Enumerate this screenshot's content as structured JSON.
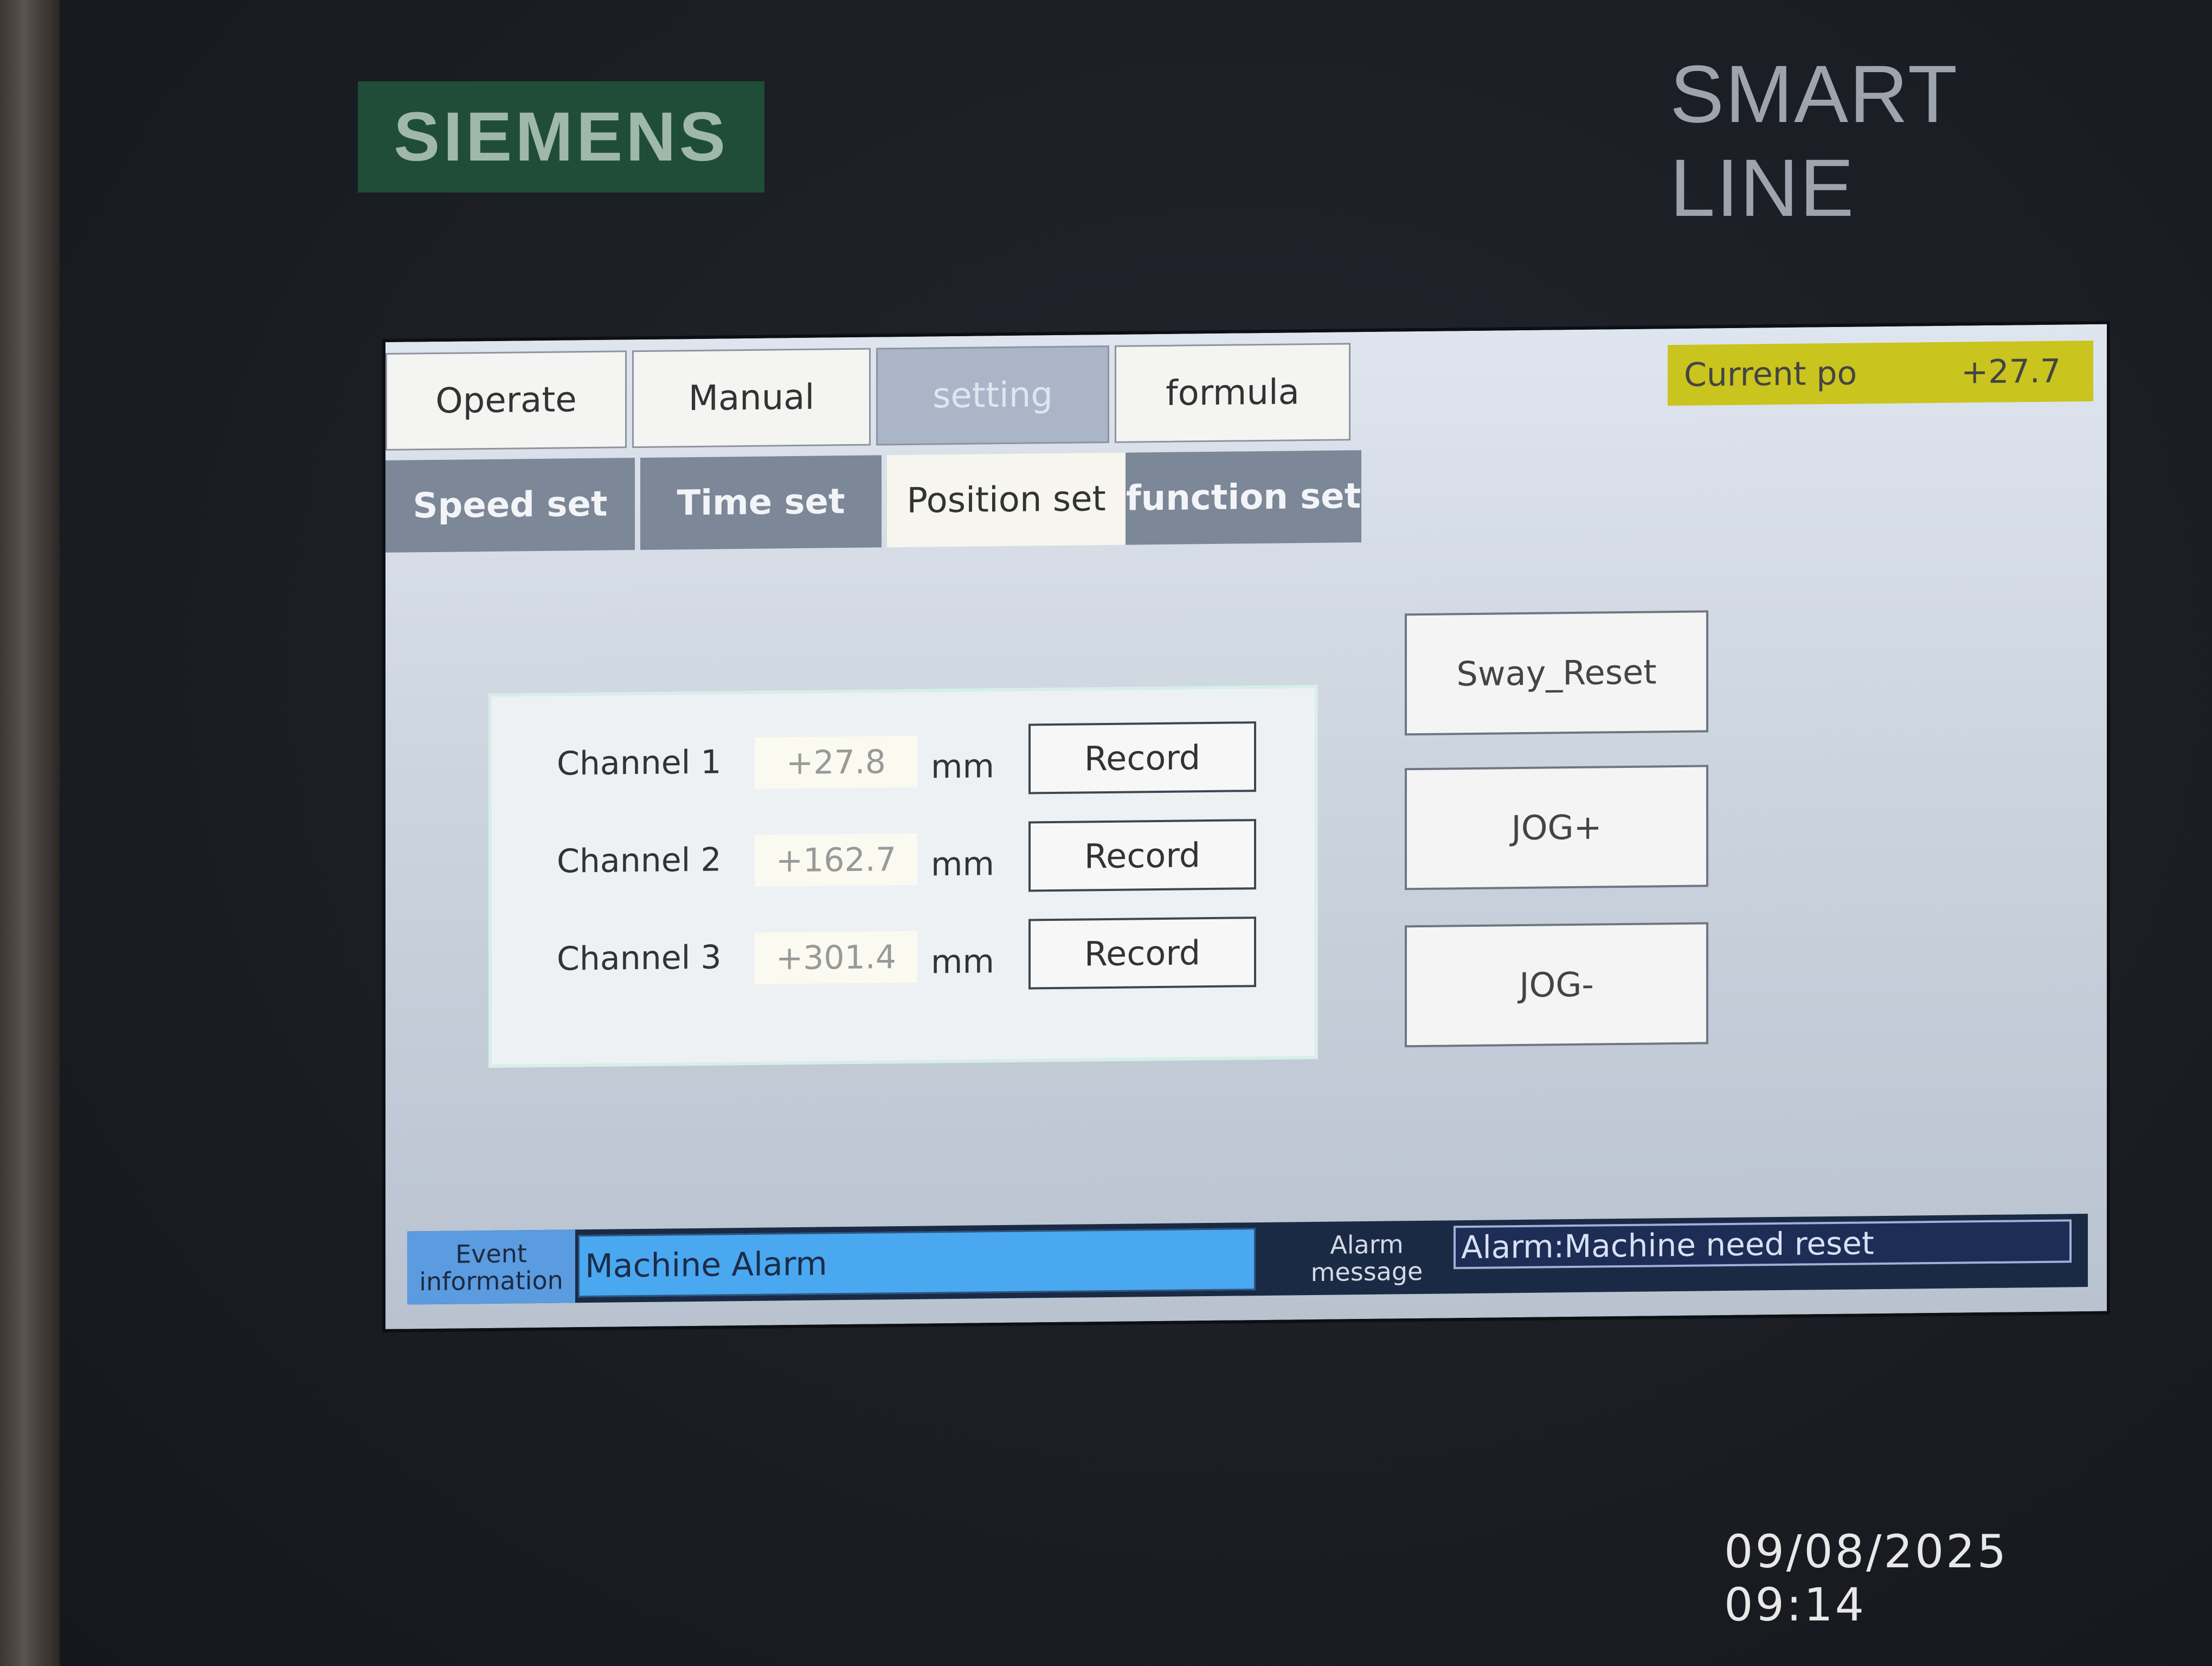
{
  "device": {
    "brand": "SIEMENS",
    "product_line": "SMART LINE",
    "photo_timestamp": "09/08/2025 09:14"
  },
  "tabs": [
    {
      "label": "Operate",
      "active": false
    },
    {
      "label": "Manual",
      "active": false
    },
    {
      "label": "setting",
      "active": true
    },
    {
      "label": "formula",
      "active": false
    }
  ],
  "subtabs": [
    {
      "label": "Speed set",
      "active": false
    },
    {
      "label": "Time set",
      "active": false
    },
    {
      "label": "Position set",
      "active": true
    },
    {
      "label": "function  set",
      "active": false
    }
  ],
  "current_position": {
    "label": "Current po",
    "value": "+27.7"
  },
  "channels": [
    {
      "label": "Channel 1",
      "value": "+27.8",
      "unit": "mm",
      "button": "Record"
    },
    {
      "label": "Channel 2",
      "value": "+162.7",
      "unit": "mm",
      "button": "Record"
    },
    {
      "label": "Channel 3",
      "value": "+301.4",
      "unit": "mm",
      "button": "Record"
    }
  ],
  "side_buttons": {
    "sway_reset": "Sway_Reset",
    "jog_plus": "JOG+",
    "jog_minus": "JOG-"
  },
  "status": {
    "event_label": "Event information",
    "event_value": "Machine Alarm",
    "alarm_label": "Alarm message",
    "alarm_value": "Alarm:Machine need reset"
  },
  "colors": {
    "brand_green": "#1f4d38",
    "current_pos_bg": "#c9c41e",
    "event_field_bg": "#4aa8f0",
    "alarm_field_bg": "#1d2d55"
  }
}
